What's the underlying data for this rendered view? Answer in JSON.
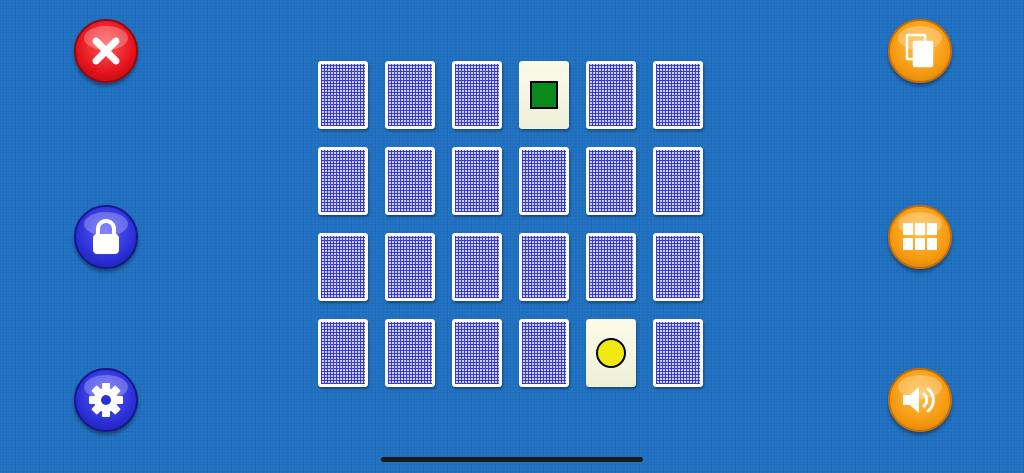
{
  "colors": {
    "table": "#1e6fc0",
    "green_shape": "#0a8a1c",
    "yellow_shape": "#f0ea12"
  },
  "left_buttons": [
    {
      "name": "close-button",
      "icon": "close-icon",
      "style": "red"
    },
    {
      "name": "lock-button",
      "icon": "lock-icon",
      "style": "blue"
    },
    {
      "name": "settings-button",
      "icon": "gear-icon",
      "style": "blue"
    }
  ],
  "right_buttons": [
    {
      "name": "cards-button",
      "icon": "cards-icon",
      "style": "orange"
    },
    {
      "name": "grid-button",
      "icon": "grid-icon",
      "style": "orange"
    },
    {
      "name": "sound-button",
      "icon": "speaker-icon",
      "style": "orange"
    }
  ],
  "board": {
    "rows": 4,
    "cols": 6,
    "cards": [
      "back",
      "back",
      "back",
      "green-square",
      "back",
      "back",
      "back",
      "back",
      "back",
      "back",
      "back",
      "back",
      "back",
      "back",
      "back",
      "back",
      "back",
      "back",
      "back",
      "back",
      "back",
      "back",
      "yellow-circle",
      "back"
    ]
  }
}
